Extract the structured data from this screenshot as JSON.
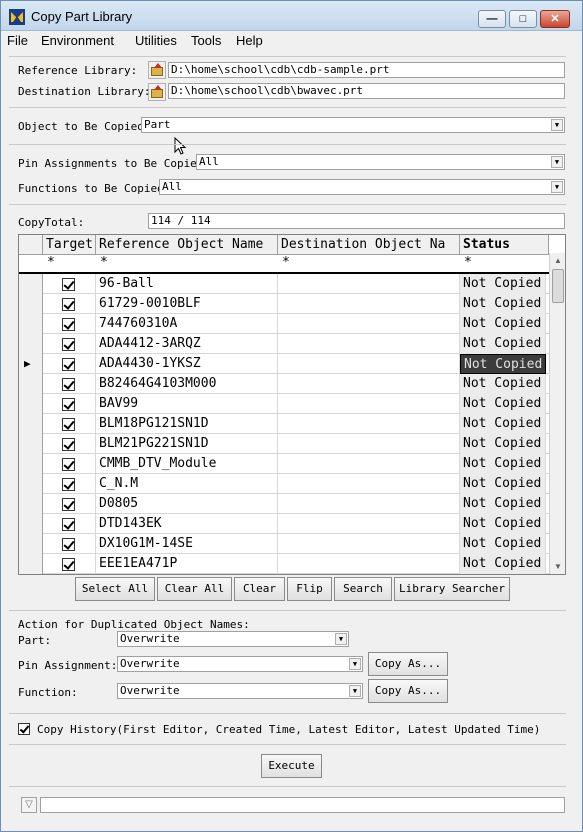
{
  "window": {
    "title": "Copy Part Library",
    "minimize": "—",
    "maximize": "□",
    "close": "✕"
  },
  "menu": [
    "File",
    "Environment",
    "Utilities",
    "Tools",
    "Help"
  ],
  "reference_library": {
    "label": "Reference Library:",
    "value": "D:\\home\\school\\cdb\\cdb-sample.prt"
  },
  "destination_library": {
    "label": "Destination Library:",
    "value": "D:\\home\\school\\cdb\\bwavec.prt"
  },
  "object_to_copy": {
    "label": "Object to Be Copied:",
    "value": "Part"
  },
  "pin_assignments": {
    "label": "Pin Assignments to Be Copied:",
    "value": "All"
  },
  "functions": {
    "label": "Functions to Be Copied:",
    "value": "All"
  },
  "copy_total": {
    "label": "CopyTotal:",
    "value": "114 / 114"
  },
  "grid": {
    "headers": {
      "target": "Target",
      "reference": "Reference Object Name",
      "destination": "Destination Object Na",
      "status": "Status"
    },
    "filters": {
      "target": "*",
      "reference": "*",
      "destination": "*",
      "status": "*"
    },
    "current_row_marker": "▶",
    "rows": [
      {
        "name": "96-Ball",
        "dest": "",
        "status": "Not Copied"
      },
      {
        "name": "61729-0010BLF",
        "dest": "",
        "status": "Not Copied"
      },
      {
        "name": "744760310A",
        "dest": "",
        "status": "Not Copied"
      },
      {
        "name": "ADA4412-3ARQZ",
        "dest": "",
        "status": "Not Copied"
      },
      {
        "name": "ADA4430-1YKSZ",
        "dest": "",
        "status": "Not Copied"
      },
      {
        "name": "B82464G4103M000",
        "dest": "",
        "status": "Not Copied"
      },
      {
        "name": "BAV99",
        "dest": "",
        "status": "Not Copied"
      },
      {
        "name": "BLM18PG121SN1D",
        "dest": "",
        "status": "Not Copied"
      },
      {
        "name": "BLM21PG221SN1D",
        "dest": "",
        "status": "Not Copied"
      },
      {
        "name": "CMMB_DTV_Module",
        "dest": "",
        "status": "Not Copied"
      },
      {
        "name": "C_N.M",
        "dest": "",
        "status": "Not Copied"
      },
      {
        "name": "D0805",
        "dest": "",
        "status": "Not Copied"
      },
      {
        "name": "DTD143EK",
        "dest": "",
        "status": "Not Copied"
      },
      {
        "name": "DX10G1M-14SE",
        "dest": "",
        "status": "Not Copied"
      },
      {
        "name": "EEE1EA471P",
        "dest": "",
        "status": "Not Copied"
      }
    ]
  },
  "buttons": {
    "select_all": "Select All",
    "clear_all": "Clear All",
    "clear": "Clear",
    "flip": "Flip",
    "search": "Search",
    "library_searcher": "Library Searcher"
  },
  "duplicate_section": {
    "heading": "Action for Duplicated Object Names:",
    "part": {
      "label": "Part:",
      "value": "Overwrite"
    },
    "pin_assignment": {
      "label": "Pin Assignment:",
      "value": "Overwrite",
      "button": "Copy As..."
    },
    "function": {
      "label": "Function:",
      "value": "Overwrite",
      "button": "Copy As..."
    }
  },
  "copy_history": {
    "label": "Copy History(First Editor, Created Time, Latest Editor, Latest Updated Time)",
    "checked": true
  },
  "execute": "Execute",
  "icons": {
    "app": "app-icon",
    "folder": "folder-up-icon",
    "dropdown": "chevron-down-icon",
    "status": "filter-icon"
  }
}
